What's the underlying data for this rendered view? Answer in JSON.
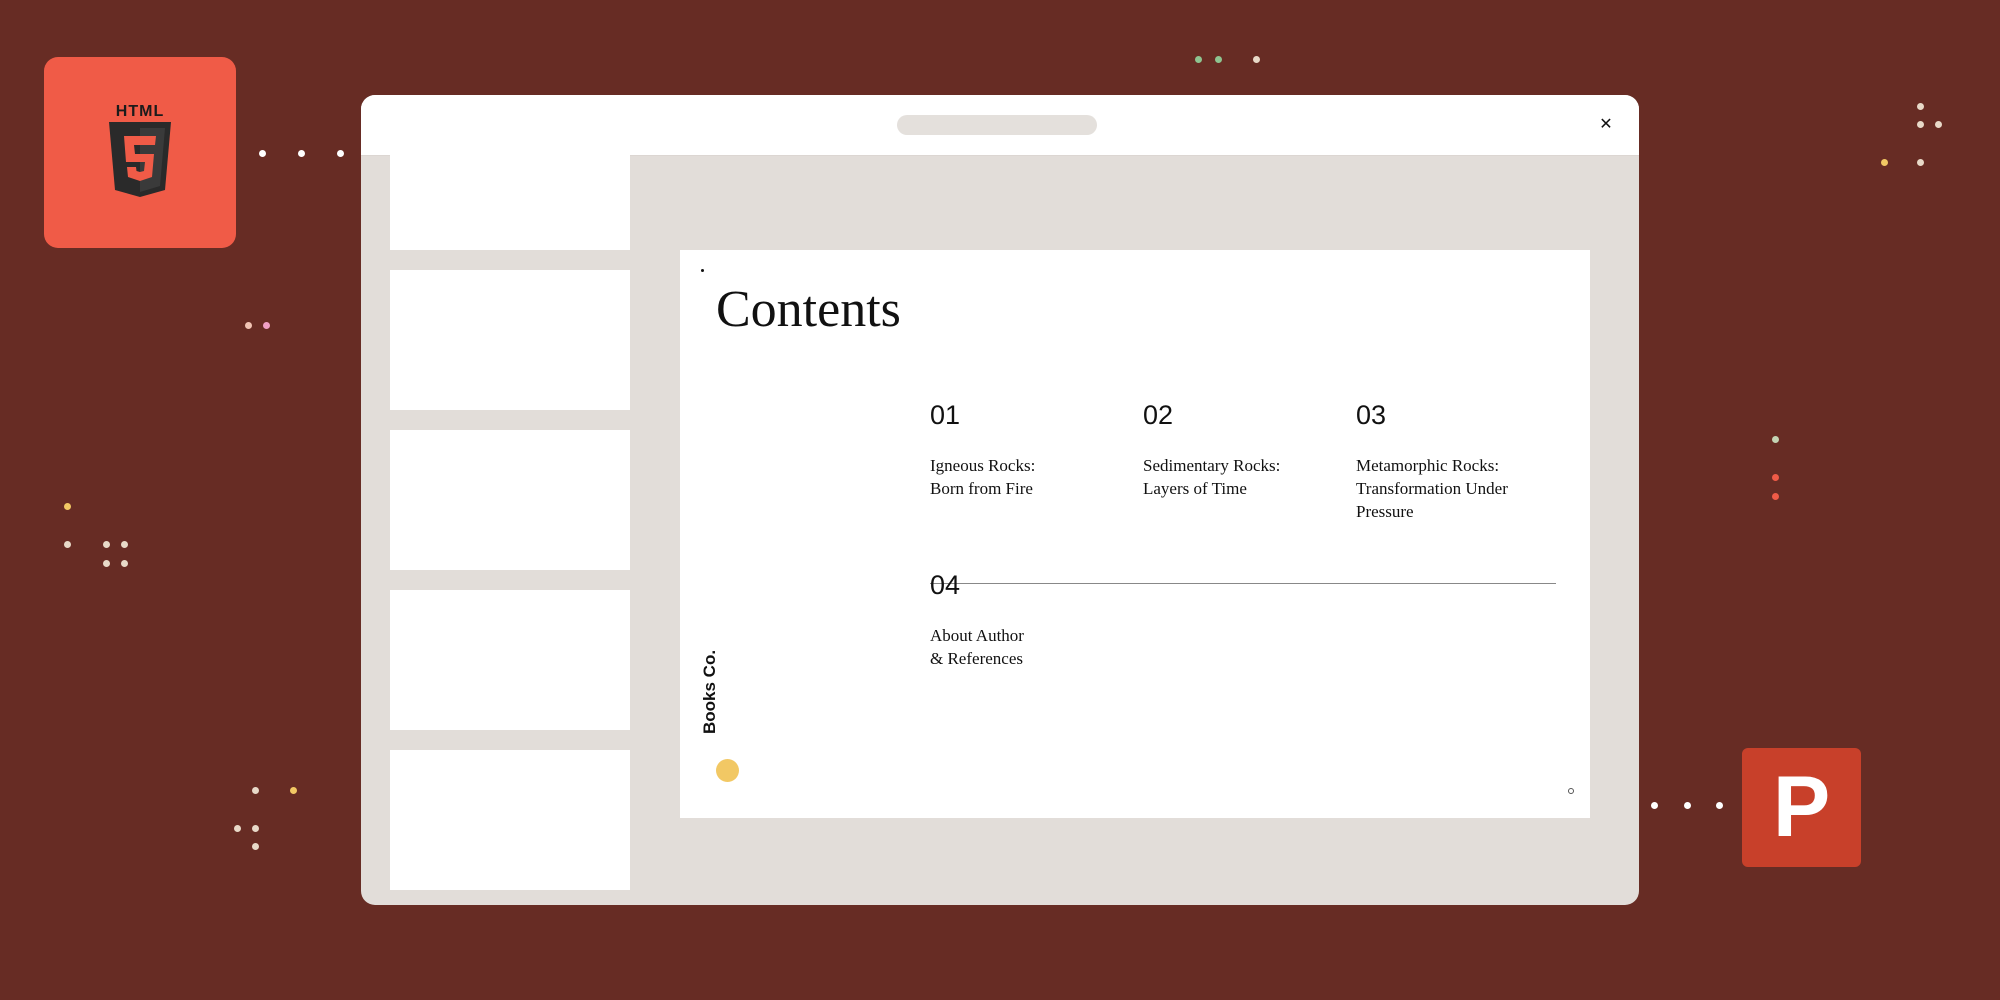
{
  "badges": {
    "html_label": "HTML",
    "html_icon": "html5-shield-icon",
    "ppt_letter": "P",
    "ppt_icon": "powerpoint-icon"
  },
  "window": {
    "close_icon": "close-icon"
  },
  "slide": {
    "title": "Contents",
    "brand": "Books Co.",
    "items": [
      {
        "number": "01",
        "line1": "Igneous Rocks:",
        "line2": "Born from Fire",
        "line3": ""
      },
      {
        "number": "02",
        "line1": "Sedimentary Rocks:",
        "line2": "Layers of Time",
        "line3": ""
      },
      {
        "number": "03",
        "line1": "Metamorphic Rocks:",
        "line2": "Transformation Under",
        "line3": "Pressure"
      },
      {
        "number": "04",
        "line1": "About Author",
        "line2": "& References",
        "line3": ""
      }
    ]
  },
  "colors": {
    "background": "#672c24",
    "html_badge": "#f05b47",
    "ppt_badge": "#c8402a",
    "brand_circle": "#f2c864"
  }
}
